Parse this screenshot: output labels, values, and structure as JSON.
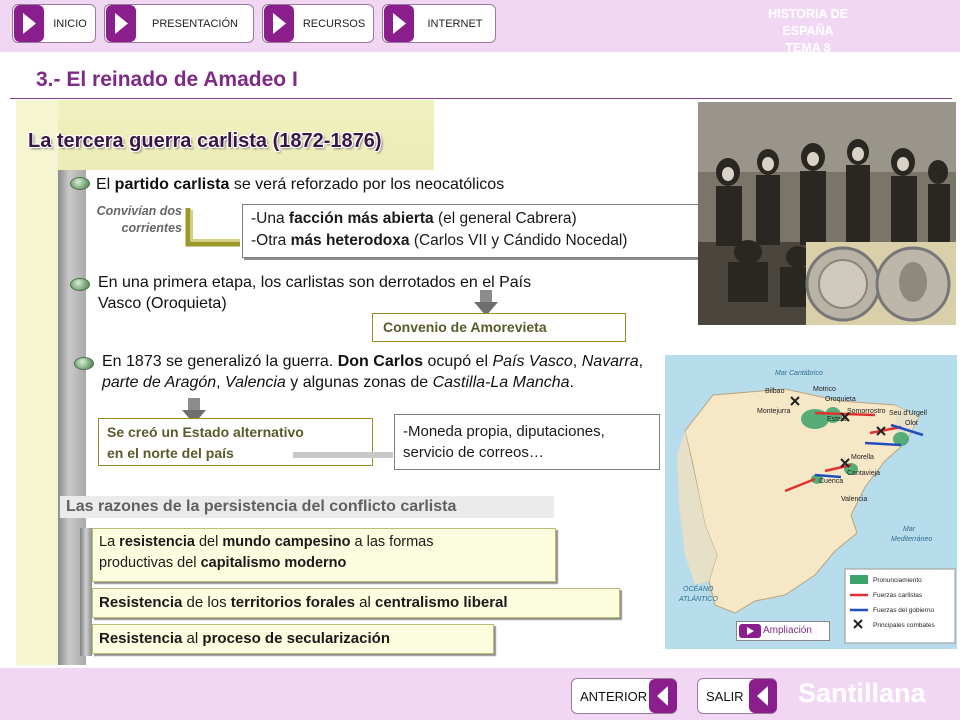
{
  "nav": {
    "buttons": [
      "INICIO",
      "PRESENTACIÓN",
      "RECURSOS",
      "INTERNET"
    ],
    "course_title_1": "HISTORIA DE ESPAÑA",
    "course_title_2": "TEMA 8"
  },
  "page": {
    "title": "3.- El reinado de Amadeo I",
    "section_title": "La tercera guerra carlista (1872-1876)"
  },
  "points": {
    "p1": {
      "a": "El ",
      "b": "partido carlista",
      "c": " se verá reforzado por los neocatólicos"
    },
    "p1_side": {
      "line1": "Convivían dos",
      "line2": "corrientes"
    },
    "p1_box": {
      "l1a": "-Una ",
      "l1b": "facción más abierta",
      "l1c": " (el general Cabrera)",
      "l2a": "-Otra ",
      "l2b": "más heterodoxa",
      "l2c": " (Carlos VII y Cándido Nocedal)"
    },
    "p2": {
      "line1": "En una primera etapa, los carlistas son derrotados en el País",
      "line2": "Vasco (Oroquieta)"
    },
    "p2_box": "Convenio de Amorevieta",
    "p3": {
      "a": "En 1873 se generalizó la guerra. ",
      "b": "Don Carlos",
      "c": " ocupó el ",
      "d": "País Vasco",
      "e": ", ",
      "f": "Navarra",
      "g": ",",
      "h": "parte de Aragón",
      "i": ", ",
      "j": "Valencia",
      "k": " y algunas zonas de ",
      "l": "Castilla-La Mancha",
      "m": "."
    },
    "state_box": {
      "line1": "Se creó un Estado alternativo",
      "line2": "en el norte del país"
    },
    "state_detail": {
      "line1": "-Moneda propia, diputaciones,",
      "line2": "servicio de correos…"
    }
  },
  "reasons": {
    "title": "Las razones de la persistencia del conflicto carlista",
    "r1": {
      "a": "La ",
      "b": "resistencia",
      "c": " del ",
      "d": "mundo campesino",
      "e": " a las formas",
      "f": "productivas del ",
      "g": "capitalismo moderno"
    },
    "r2": {
      "a": "Resistencia",
      "b": " de los ",
      "c": "territorios forales",
      "d": " al ",
      "e": "centralismo liberal"
    },
    "r3": {
      "a": "Resistencia",
      "b": " al ",
      "c": "proceso de secularización"
    }
  },
  "map": {
    "sea_top": "Mar Cantábrico",
    "sea_east_1": "Mar",
    "sea_east_2": "Mediterráneo",
    "ocean_1": "OCÉANO",
    "ocean_2": "ATLÁNTICO",
    "cities": [
      "Bilbao",
      "Montejurra",
      "Motrico",
      "Oroquieta",
      "Somorrostro",
      "Estella",
      "Seu d'Urgell",
      "Olot",
      "Morella",
      "Cantavieja",
      "Cuenca",
      "Valencia"
    ],
    "legend": [
      "Pronunciamiento",
      "Fuerzas carlistas",
      "Fuerzas del gobierno",
      "Principales combates"
    ],
    "ampliacion": "Ampliación",
    "colors": {
      "carlist": "#e03030",
      "government": "#2050c0",
      "pronunciamiento": "#3ca36b"
    }
  },
  "footer": {
    "prev": "ANTERIOR",
    "exit": "SALIR",
    "brand": "Santillana"
  }
}
